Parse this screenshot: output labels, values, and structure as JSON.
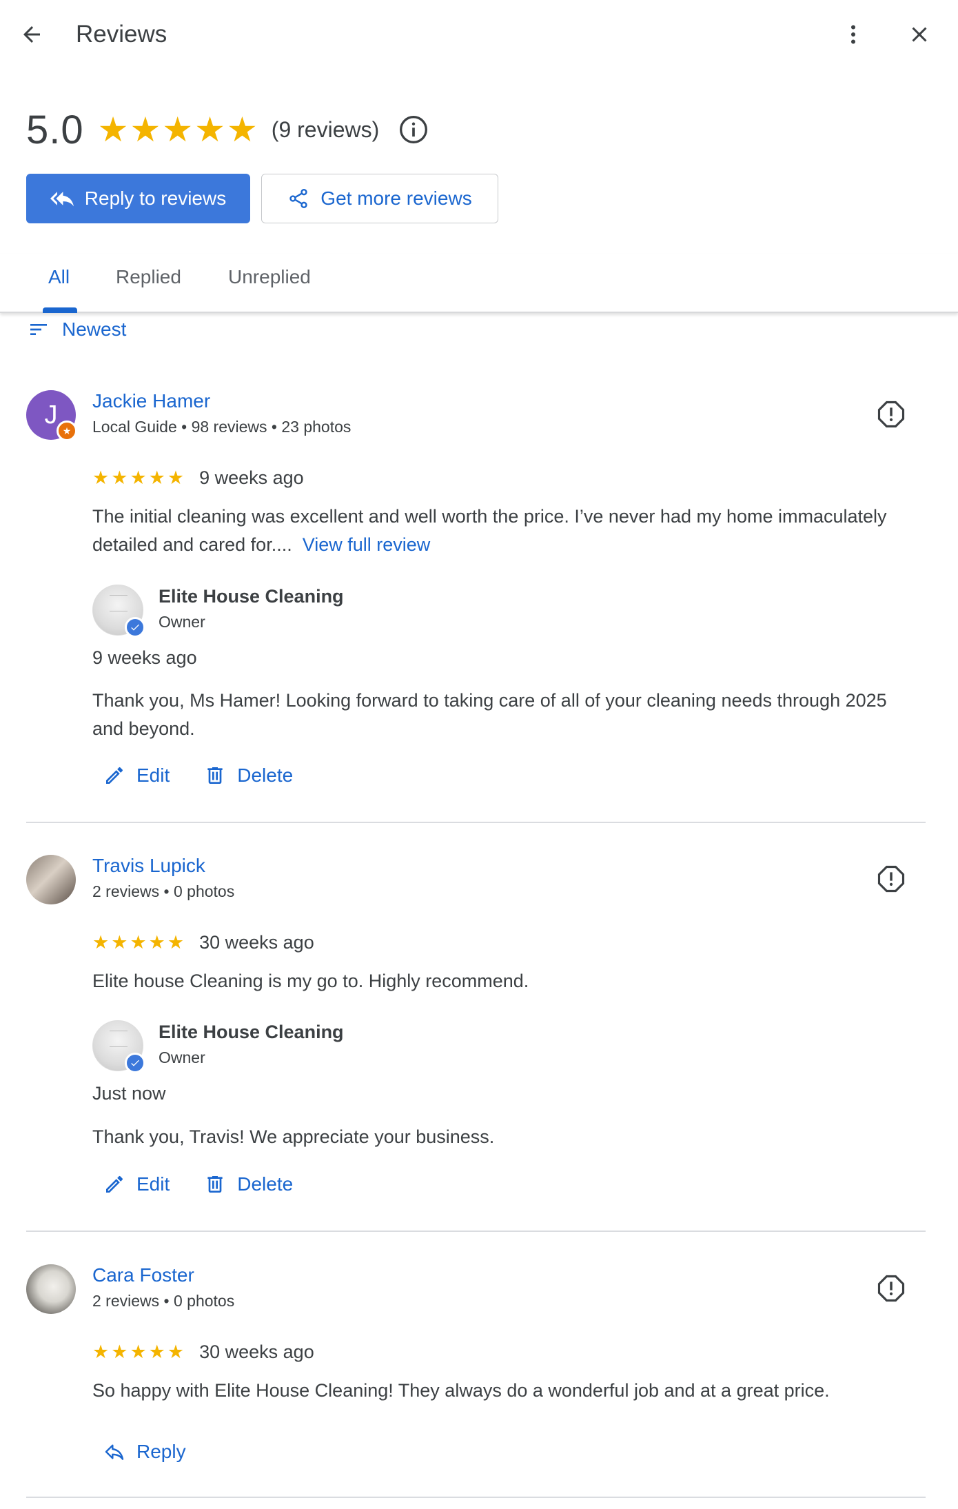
{
  "header": {
    "title": "Reviews",
    "back_icon": "arrow-back-icon",
    "more_icon": "more-vert-icon",
    "close_icon": "close-icon"
  },
  "summary": {
    "rating": "5.0",
    "stars": 5,
    "review_count": "(9 reviews)",
    "info_icon": "info-icon"
  },
  "actions": {
    "reply_to_reviews": "Reply to reviews",
    "get_more_reviews": "Get more reviews"
  },
  "tabs": [
    {
      "label": "All",
      "active": true
    },
    {
      "label": "Replied",
      "active": false
    },
    {
      "label": "Unreplied",
      "active": false
    }
  ],
  "sort": {
    "label": "Newest"
  },
  "colors": {
    "accent": "#1a66cf",
    "primary_button": "#3c78db",
    "star": "#f4b400",
    "avatar_purple": "#7e57c2",
    "local_guide_badge": "#e8710a"
  },
  "reviews": [
    {
      "name": "Jackie Hamer",
      "avatar_letter": "J",
      "meta": "Local Guide • 98 reviews • 23 photos",
      "stars": 5,
      "date": "9 weeks ago",
      "text": "The initial cleaning was excellent and well worth the price. I’ve never had my home immaculately detailed and cared for....",
      "view_full": "View full review",
      "reply": {
        "owner_name": "Elite House Cleaning",
        "owner_role": "Owner",
        "date": "9 weeks ago",
        "text": "Thank you, Ms Hamer! Looking forward to taking care of all of your cleaning needs through 2025 and beyond."
      },
      "edit_label": "Edit",
      "delete_label": "Delete"
    },
    {
      "name": "Travis Lupick",
      "meta": "2 reviews • 0 photos",
      "stars": 5,
      "date": "30 weeks ago",
      "text": "Elite house Cleaning is my go to. Highly recommend.",
      "reply": {
        "owner_name": "Elite House Cleaning",
        "owner_role": "Owner",
        "date": "Just now",
        "text": "Thank you, Travis! We appreciate your business."
      },
      "edit_label": "Edit",
      "delete_label": "Delete"
    },
    {
      "name": "Cara Foster",
      "meta": "2 reviews • 0 photos",
      "stars": 5,
      "date": "30 weeks ago",
      "text": "So happy with Elite House Cleaning! They always do a wonderful job and at a great price.",
      "reply_label": "Reply"
    }
  ]
}
